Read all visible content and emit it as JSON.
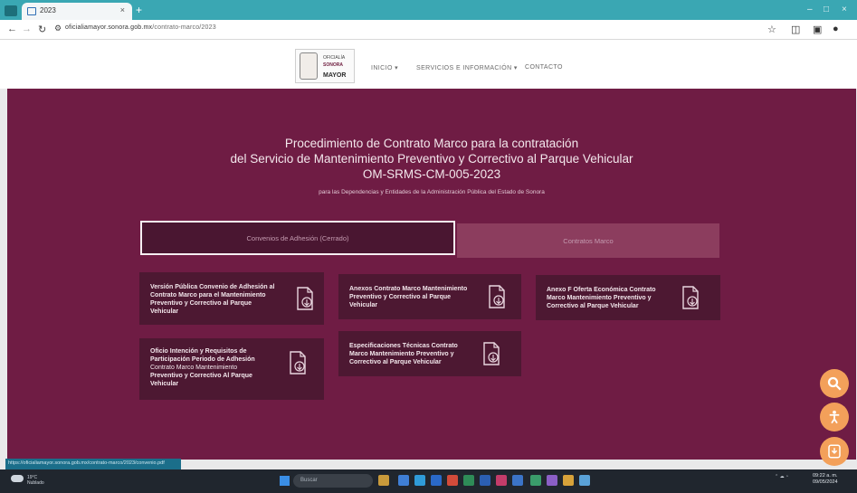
{
  "browser": {
    "tab_title": "2023",
    "tab_close": "×",
    "new_tab": "+",
    "url_host": "oficialiamayor.sonora.gob.mx",
    "url_path": "/contrato-marco/2023",
    "window_controls": [
      "–",
      "□",
      "×"
    ]
  },
  "header": {
    "logo_line1": "OFICIALÍA",
    "logo_line2": "SONORA",
    "logo_line3": "MAYOR",
    "menu": [
      "INICIO ▾",
      "SERVICIOS E INFORMACIÓN ▾",
      "CONTACTO"
    ]
  },
  "main": {
    "title_line1": "Procedimiento de Contrato Marco para la contratación",
    "title_line2": "del Servicio de Mantenimiento Preventivo y Correctivo al Parque Vehicular",
    "title_line3": "OM-SRMS-CM-005-2023",
    "subtitle": "para las Dependencias y Entidades de la Administración Pública del Estado de Sonora",
    "tabs": [
      {
        "label": "Convenios de Adhesión (Cerrado)"
      },
      {
        "label": "Contratos Marco"
      }
    ],
    "cards": [
      {
        "lines": [
          "Versión Pública Convenio de Adhesión al",
          "Contrato Marco para el Mantenimiento",
          "Preventivo y Correctivo al Parque",
          "Vehicular"
        ]
      },
      {
        "lines": [
          "Anexos Contrato Marco Mantenimiento",
          "Preventivo y Correctivo al Parque",
          "Vehicular"
        ]
      },
      {
        "lines": [
          "Anexo F Oferta Económica Contrato",
          "Marco Mantenimiento Preventivo y",
          "Correctivo al Parque Vehicular"
        ]
      },
      {
        "lines": [
          "Oficio Intención y Requisitos de",
          "Participación Periodo de Adhesión",
          "Contrato Marco Mantenimiento",
          "Preventivo y Correctivo Al Parque",
          "Vehicular"
        ]
      },
      {
        "lines": [
          "Especificaciones Técnicas Contrato",
          "Marco Mantenimiento Preventivo y",
          "Correctivo al Parque Vehicular"
        ]
      }
    ]
  },
  "status_url": "https://oficialiamayor.sonora.gob.mx/contrato-marco/2023/convenio.pdf",
  "taskbar": {
    "weather_temp": "19°C",
    "weather_desc": "Nublado",
    "search_placeholder": "Buscar",
    "time": "09:22 a. m.",
    "date": "09/05/2024"
  },
  "colors": {
    "main_bg": "#6f1c44",
    "card_bg": "#4d1832",
    "fab": "#f3a05a",
    "browser_accent": "#3aa7b3"
  }
}
